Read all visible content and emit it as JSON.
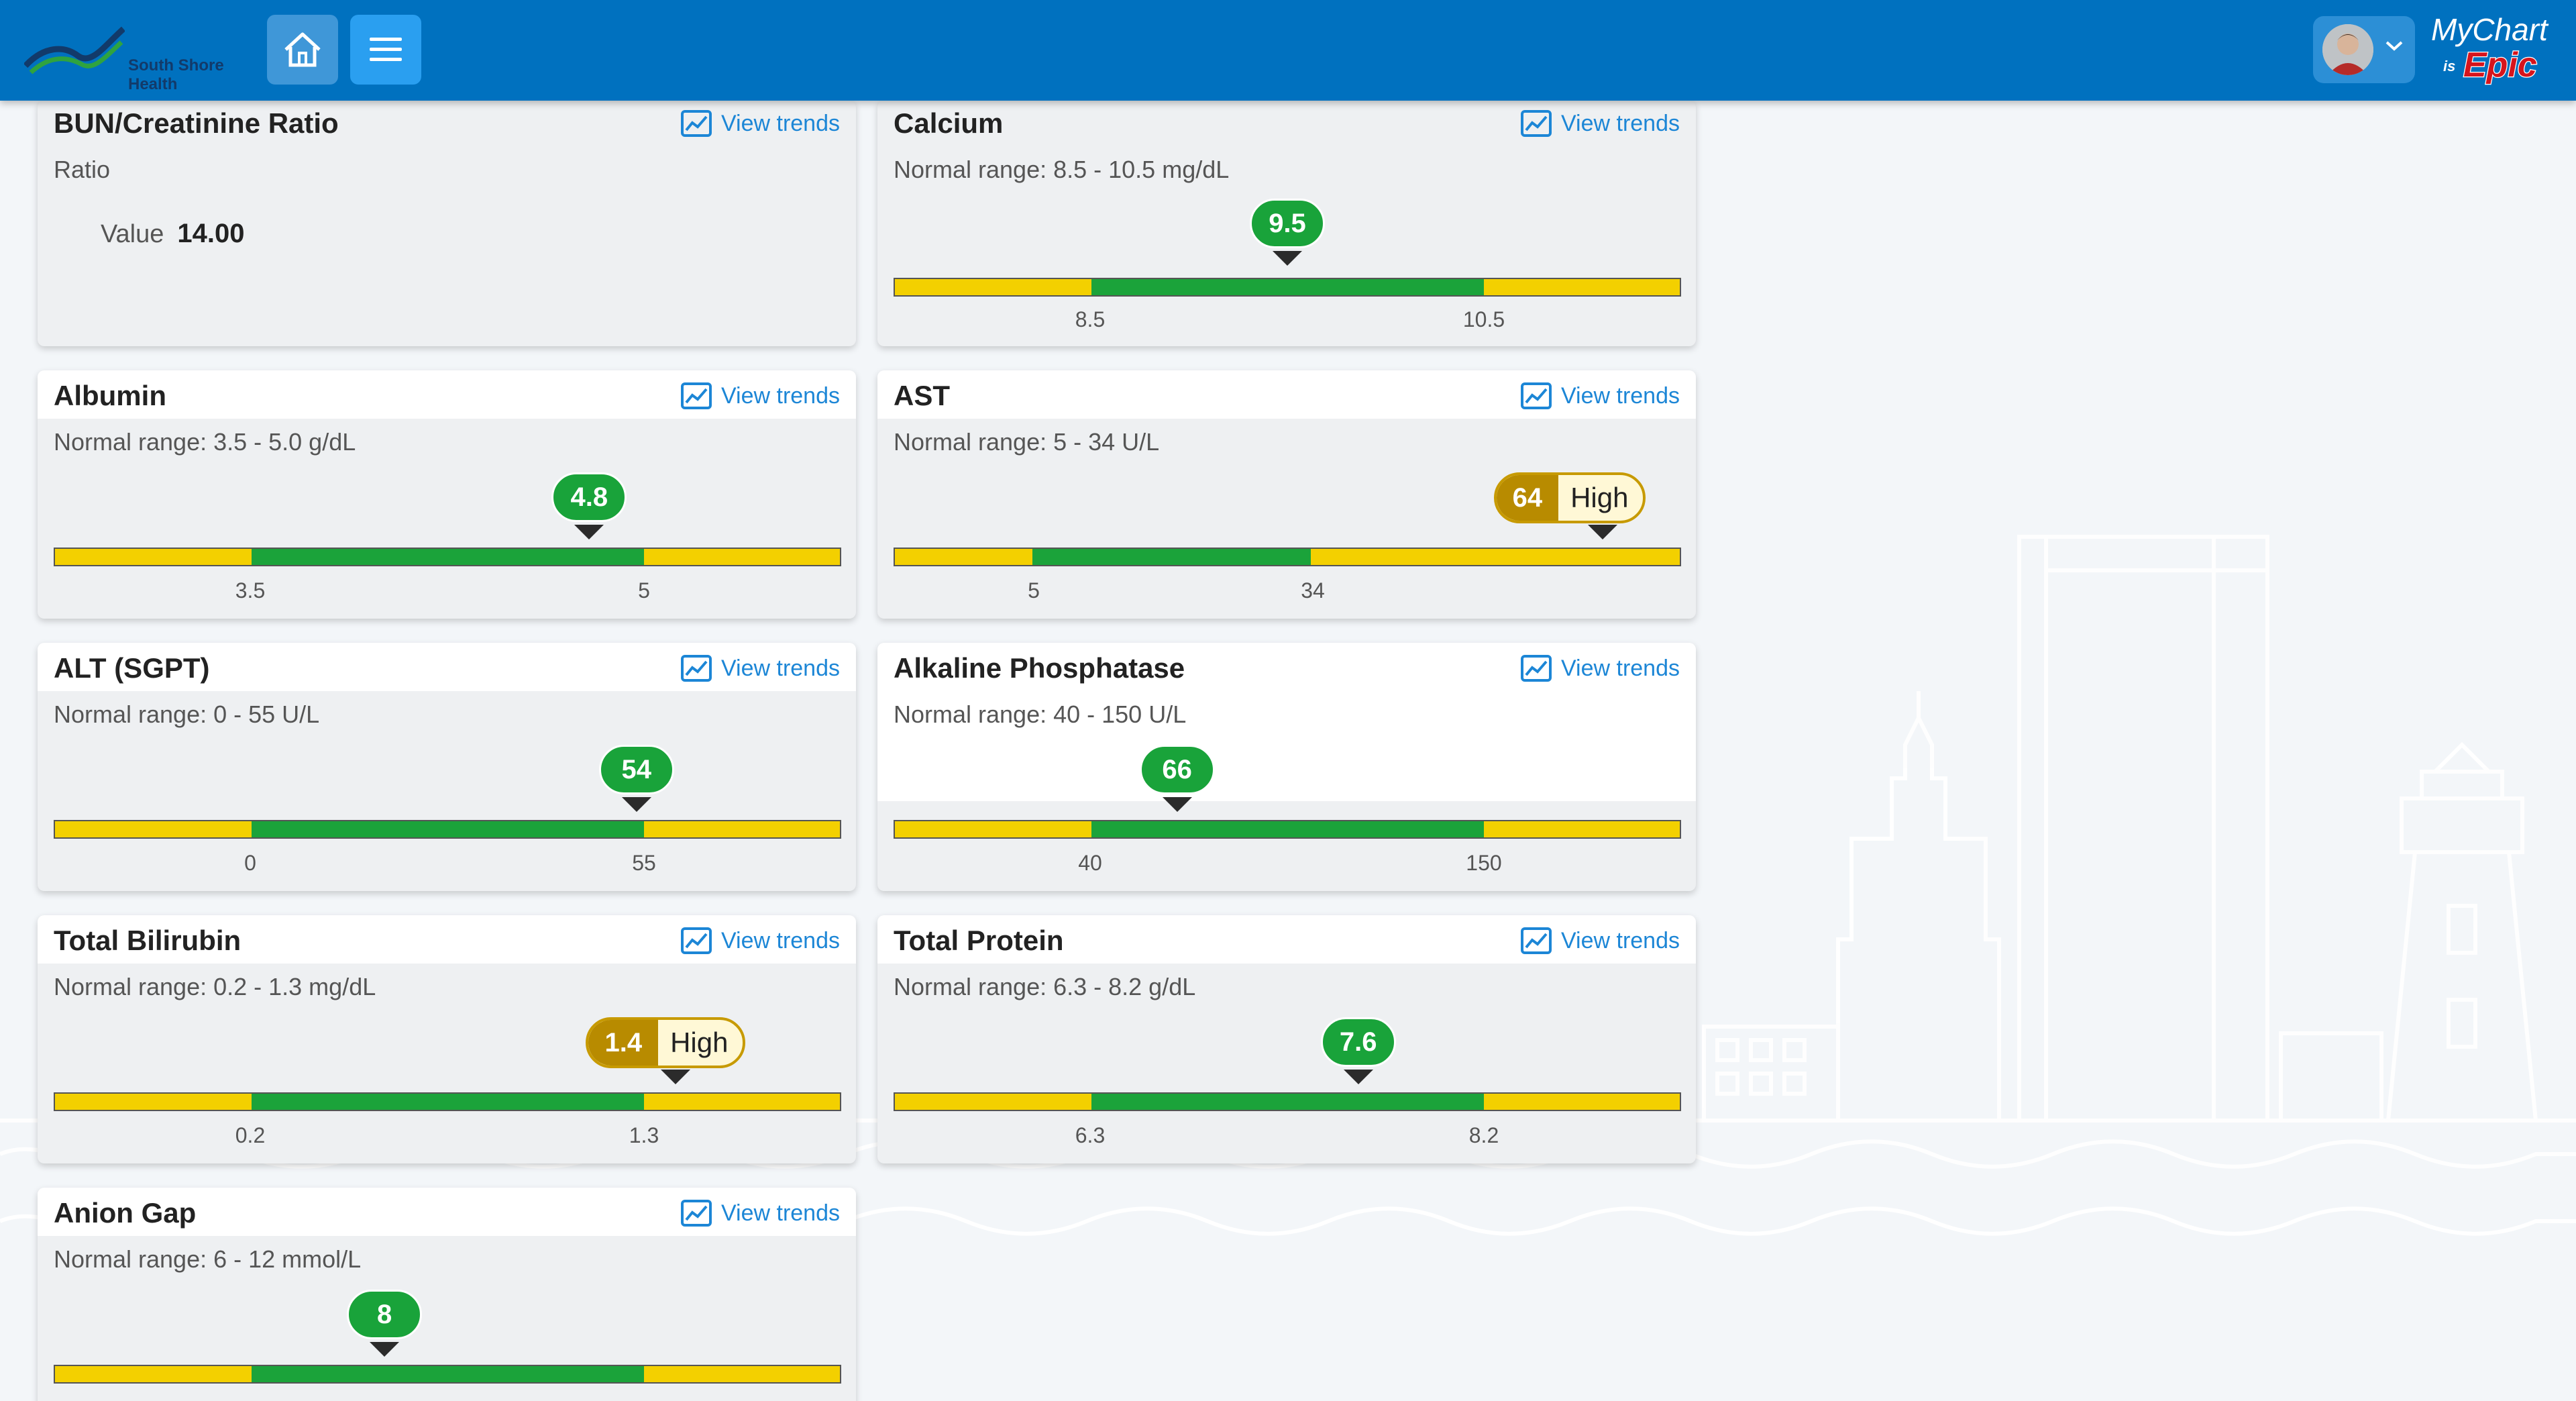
{
  "header": {
    "org_name_line1": "South Shore",
    "org_name_line2": "Health",
    "brand_color": "#0071bf",
    "home_icon": "home-icon",
    "menu_icon": "menu-icon",
    "mychart_line1": "MyChart",
    "mychart_is": "is",
    "mychart_epic": "Epic"
  },
  "trends_label": "View trends",
  "cards": [
    {
      "title": "BUN/Creatinine Ratio",
      "subtitle": "Ratio",
      "value_label": "Value",
      "value": "14.00"
    },
    {
      "title": "Calcium",
      "range": "Normal range: 8.5 - 10.5 mg/dL",
      "result": "9.5",
      "result_fraction": 0.5,
      "status": "normal",
      "low_tick": "8.5",
      "high_tick": "10.5"
    },
    {
      "title": "Albumin",
      "range": "Normal range: 3.5 - 5.0 g/dL",
      "result": "4.8",
      "result_fraction": 0.68,
      "status": "normal",
      "low_tick": "3.5",
      "high_tick": "5"
    },
    {
      "title": "AST",
      "range": "Normal range: 5 - 34 U/L",
      "result": "64",
      "result_fraction": 0.9,
      "status": "high",
      "flag": "High",
      "low_tick": "5",
      "high_tick": "34"
    },
    {
      "title": "ALT (SGPT)",
      "range": "Normal range: 0 - 55 U/L",
      "result": "54",
      "result_fraction": 0.74,
      "status": "normal",
      "low_tick": "0",
      "high_tick": "55"
    },
    {
      "title": "Alkaline Phosphatase",
      "range": "Normal range: 40 - 150 U/L",
      "result": "66",
      "result_fraction": 0.36,
      "status": "normal",
      "low_tick": "40",
      "high_tick": "150"
    },
    {
      "title": "Total Bilirubin",
      "range": "Normal range: 0.2 - 1.3 mg/dL",
      "result": "1.4",
      "result_fraction": 0.79,
      "status": "high",
      "flag": "High",
      "low_tick": "0.2",
      "high_tick": "1.3"
    },
    {
      "title": "Total Protein",
      "range": "Normal range: 6.3 - 8.2 g/dL",
      "result": "7.6",
      "result_fraction": 0.59,
      "status": "normal",
      "low_tick": "6.3",
      "high_tick": "8.2"
    },
    {
      "title": "Anion Gap",
      "range": "Normal range: 6 - 12 mmol/L",
      "result": "8",
      "result_fraction": 0.42,
      "status": "normal",
      "low_tick": "",
      "high_tick": ""
    }
  ],
  "colors": {
    "normal_band": "#1ba33a",
    "out_of_range_band": "#f3d000",
    "high_badge": "#b88b00",
    "link": "#1c86d6"
  }
}
